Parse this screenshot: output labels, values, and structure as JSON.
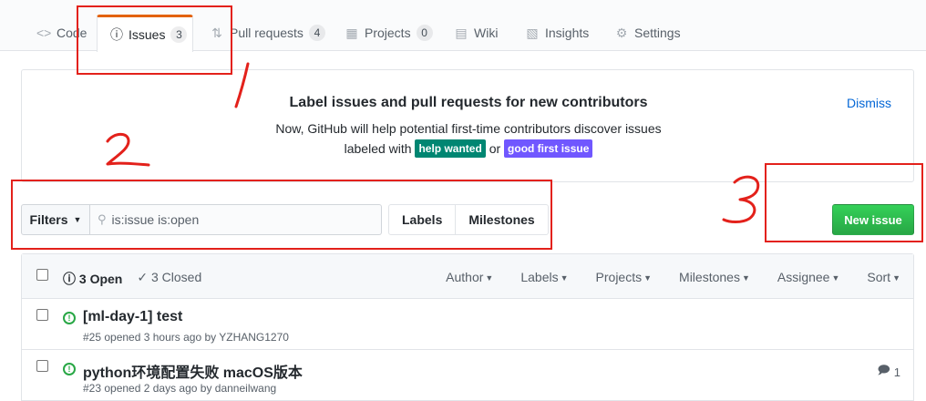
{
  "tabs": [
    {
      "label": "Code",
      "icon": "code-icon"
    },
    {
      "label": "Issues",
      "icon": "issue-opened-icon",
      "count": "3"
    },
    {
      "label": "Pull requests",
      "icon": "git-pull-request-icon",
      "count": "4"
    },
    {
      "label": "Projects",
      "icon": "project-icon",
      "count": "0"
    },
    {
      "label": "Wiki",
      "icon": "book-icon"
    },
    {
      "label": "Insights",
      "icon": "graph-icon"
    },
    {
      "label": "Settings",
      "icon": "gear-icon"
    }
  ],
  "onboarding": {
    "title": "Label issues and pull requests for new contributors",
    "line1": "Now, GitHub will help potential first-time contributors discover issues",
    "line2_prefix": "labeled with",
    "label1": "help wanted",
    "label1_color": "#008672",
    "connector": "or",
    "label2": "good first issue",
    "label2_color": "#7057ff",
    "dismiss": "Dismiss"
  },
  "filter": {
    "button": "Filters",
    "search_value": "is:issue is:open",
    "labels": "Labels",
    "milestones": "Milestones"
  },
  "new_issue": "New issue",
  "issues_header": {
    "open": "3 Open",
    "closed": "3 Closed",
    "menus": [
      "Author",
      "Labels",
      "Projects",
      "Milestones",
      "Assignee",
      "Sort"
    ]
  },
  "issues": [
    {
      "title": "[ml-day-1] test",
      "meta": "#25 opened 3 hours ago by YZHANG1270",
      "comments": ""
    },
    {
      "title": "python环境配置失败 macOS版本",
      "meta": "#23 opened 2 days ago by danneilwang",
      "comments": "1"
    }
  ],
  "annotations": [
    "1",
    "2",
    "3"
  ],
  "colors": {
    "accent": "#e36209",
    "link": "#0366d6",
    "green": "#28a745",
    "annotation": "#e3211b"
  }
}
